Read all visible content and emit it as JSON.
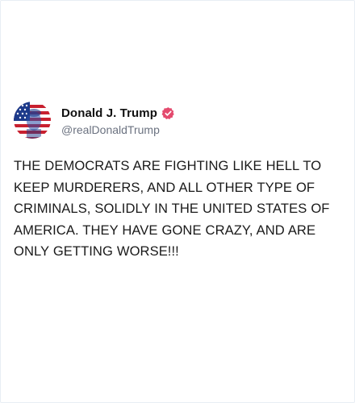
{
  "post": {
    "author": {
      "display_name": "Donald J. Trump",
      "handle": "@realDonaldTrump",
      "verified_badge_icon": "verified-badge-icon",
      "avatar_icon": "avatar-flag-portrait"
    },
    "text": "THE DEMOCRATS ARE FIGHTING LIKE HELL TO KEEP MURDERERS, AND ALL OTHER TYPE OF CRIMINALS, SOLIDLY IN THE UNITED STATES OF AMERICA. THEY HAVE GONE CRAZY, AND ARE ONLY GETTING WORSE!!!"
  },
  "colors": {
    "badge": "#e44a6e",
    "handle": "#6b7280",
    "text": "#1a1a1a"
  }
}
